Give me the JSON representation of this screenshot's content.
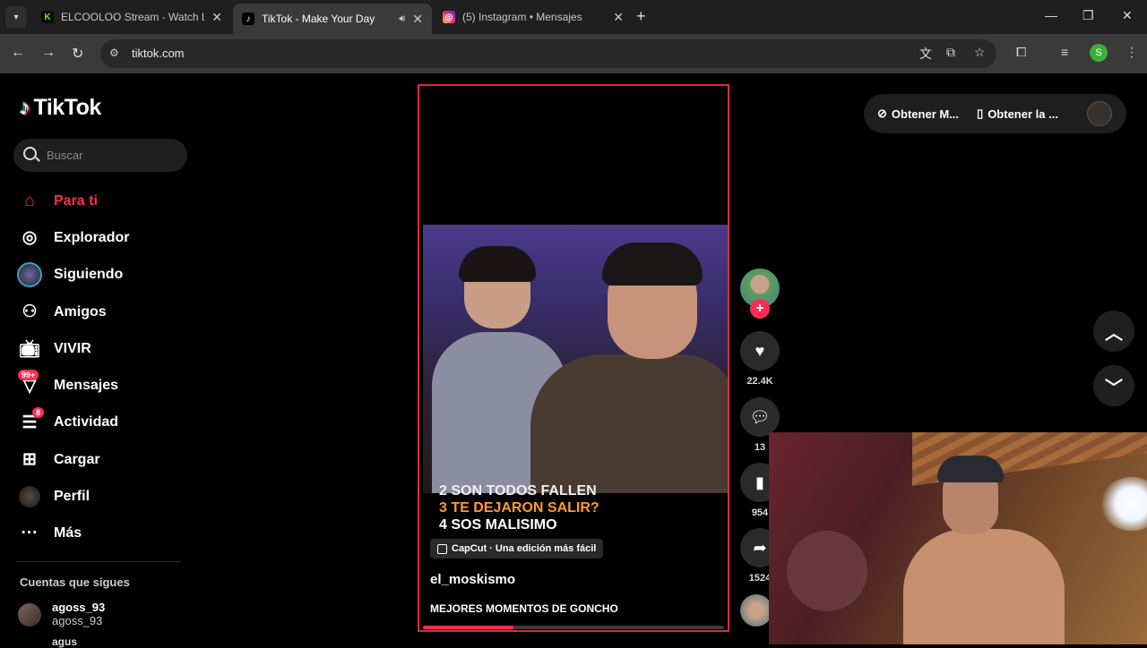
{
  "browser": {
    "tabs": [
      {
        "title": "ELCOOLOO Stream - Watch Live",
        "favicon": "kick-icon",
        "color": "#53fc18",
        "active": false
      },
      {
        "title": "TikTok - Make Your Day",
        "favicon": "tiktok-icon",
        "color": "#000000",
        "active": true,
        "sound": true
      },
      {
        "title": "(5) Instagram • Mensajes",
        "favicon": "instagram-icon",
        "color": "#e1306c",
        "active": false
      }
    ],
    "url": "tiktok.com",
    "profile_initial": "S"
  },
  "sidebar": {
    "logo_text": "TikTok",
    "search_placeholder": "Buscar",
    "nav": [
      {
        "label": "Para ti",
        "icon": "home-icon",
        "active": true
      },
      {
        "label": "Explorador",
        "icon": "compass-icon"
      },
      {
        "label": "Siguiendo",
        "icon": "following-avatar-icon"
      },
      {
        "label": "Amigos",
        "icon": "friends-icon"
      },
      {
        "label": "VIVIR",
        "icon": "live-tv-icon"
      },
      {
        "label": "Mensajes",
        "icon": "messages-icon",
        "badge": "99+"
      },
      {
        "label": "Actividad",
        "icon": "activity-icon",
        "badge": "8"
      },
      {
        "label": "Cargar",
        "icon": "upload-icon"
      },
      {
        "label": "Perfil",
        "icon": "profile-avatar-icon"
      },
      {
        "label": "Más",
        "icon": "more-icon"
      }
    ],
    "following_title": "Cuentas que sigues",
    "accounts": [
      {
        "name": "agoss_93",
        "handle": "agoss_93"
      },
      {
        "name": "agus"
      }
    ]
  },
  "video": {
    "captions": [
      "2 SON TODOS  FALLEN",
      "3 TE DEJARON SALIR?",
      "4 SOS MALISIMO"
    ],
    "capcut_label": "CapCut · Una edición más fácil",
    "author": "el_moskismo",
    "description": "MEJORES MOMENTOS DE GONCHO",
    "progress": 0.3
  },
  "actions": {
    "likes": "22.4K",
    "comments": "13",
    "saves": "954",
    "shares": "1524"
  },
  "topbar": {
    "get_coins": "Obtener M...",
    "get_app": "Obtener la ..."
  }
}
